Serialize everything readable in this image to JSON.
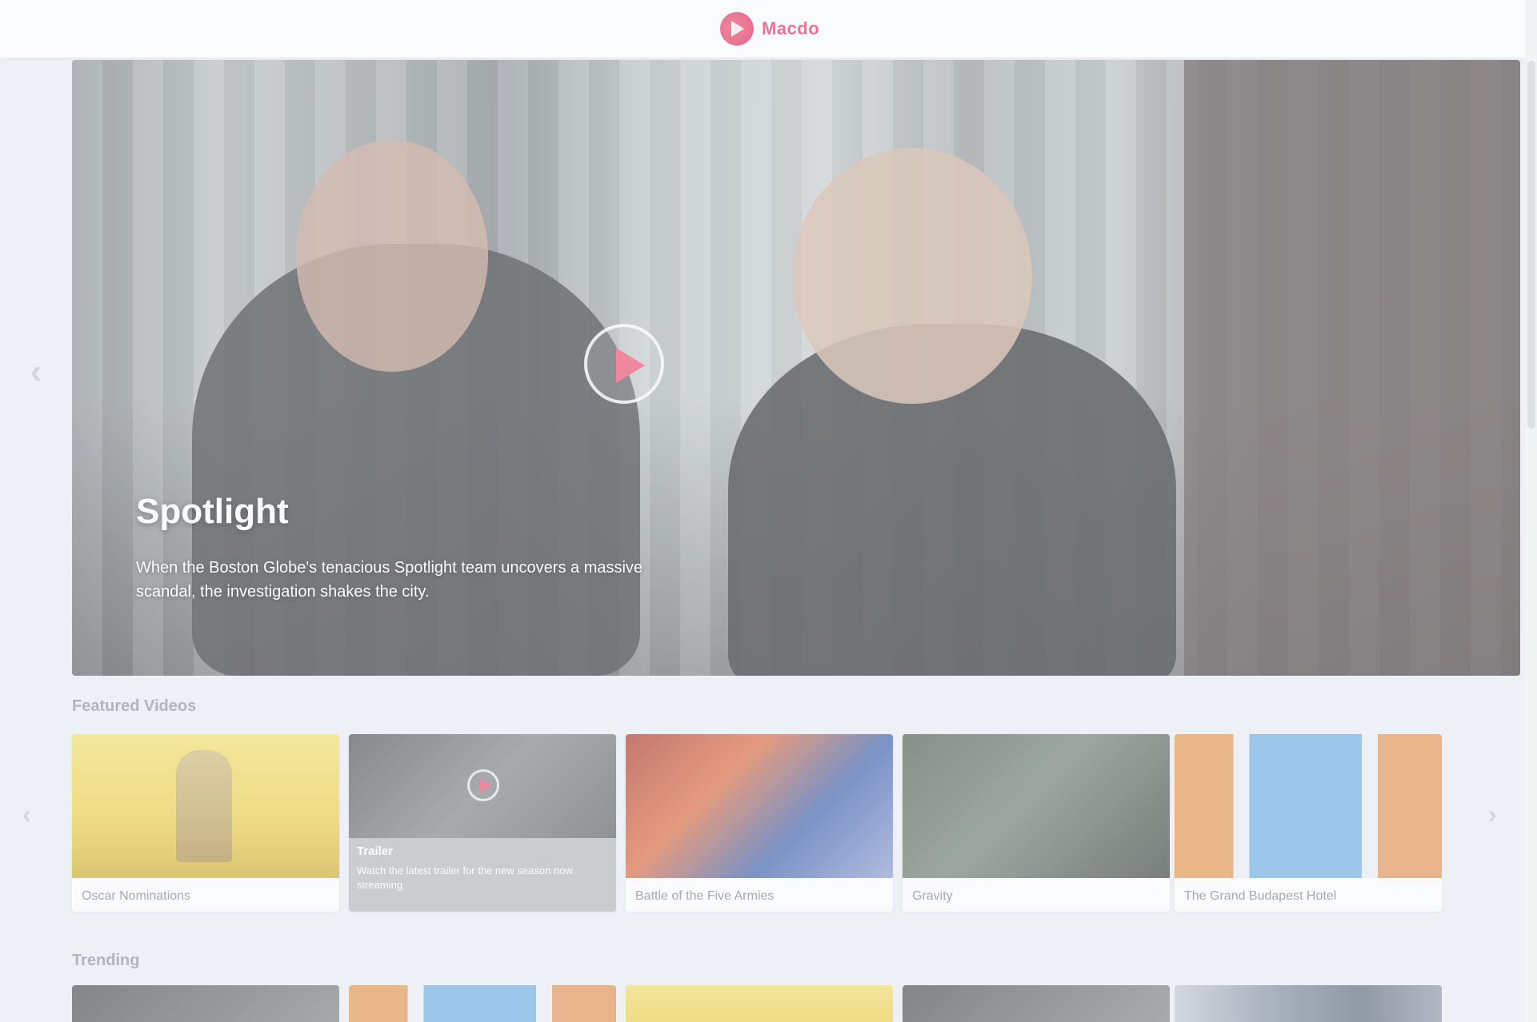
{
  "header": {
    "brand_name": "Macdo"
  },
  "hero": {
    "title": "Spotlight",
    "description": "When the Boston Globe's tenacious Spotlight team uncovers a massive scandal, the investigation shakes the city."
  },
  "sections": [
    {
      "title": "Featured Videos",
      "cards": [
        {
          "label": "Oscar Nominations"
        },
        {
          "label": "Trailer",
          "overlay_title": "Trailer",
          "overlay_sub": "Watch the latest trailer for the new season now streaming"
        },
        {
          "label": "Battle of the Five Armies"
        },
        {
          "label": "Gravity"
        },
        {
          "label": "The Grand Budapest Hotel"
        }
      ]
    },
    {
      "title": "Trending"
    }
  ],
  "colors": {
    "accent": "#e8436a",
    "background": "#eef0f4"
  }
}
